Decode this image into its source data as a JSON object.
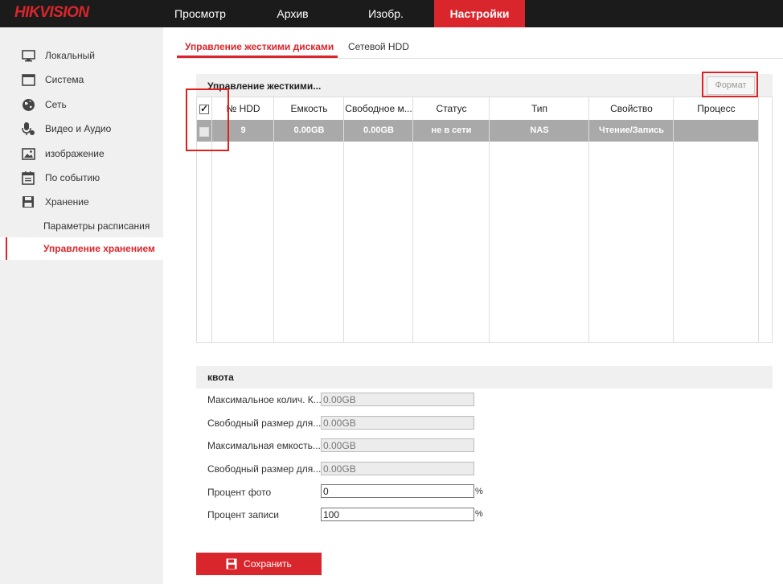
{
  "brand": "HIKVISION",
  "nav": {
    "tabs": [
      "Просмотр",
      "Архив",
      "Изобр.",
      "Настройки"
    ],
    "active": "Настройки"
  },
  "sidebar": {
    "items": [
      {
        "label": "Локальный",
        "icon": "monitor-icon"
      },
      {
        "label": "Система",
        "icon": "system-icon"
      },
      {
        "label": "Сеть",
        "icon": "globe-icon"
      },
      {
        "label": "Видео и Аудио",
        "icon": "microphone-icon"
      },
      {
        "label": "изображение",
        "icon": "image-icon"
      },
      {
        "label": "По событию",
        "icon": "calendar-icon"
      },
      {
        "label": "Хранение",
        "icon": "save-icon"
      }
    ],
    "subitems": [
      "Параметры расписания",
      "Управление хранением"
    ],
    "active_subitem": "Управление хранением"
  },
  "subtabs": [
    "Управление жесткими дисками",
    "Сетевой HDD"
  ],
  "hdd_panel": {
    "title": "Управление жесткими...",
    "format_label": "Формат",
    "columns": [
      "№ HDD",
      "Емкость",
      "Свободное м...",
      "Статус",
      "Тип",
      "Свойство",
      "Процесс"
    ],
    "header_checked": true,
    "rows": [
      {
        "checked": false,
        "hdd": "9",
        "capacity": "0.00GB",
        "free": "0.00GB",
        "status": "не в сети",
        "type": "NAS",
        "property": "Чтение/Запись",
        "process": ""
      }
    ]
  },
  "quota": {
    "title": "квота",
    "fields": [
      {
        "label": "Максимальное колич. К...",
        "value": "0.00GB",
        "readonly": true
      },
      {
        "label": "Свободный размер для...",
        "value": "0.00GB",
        "readonly": true
      },
      {
        "label": "Максимальная емкость...",
        "value": "0.00GB",
        "readonly": true
      },
      {
        "label": "Свободный размер для...",
        "value": "0.00GB",
        "readonly": true
      },
      {
        "label": "Процент фото",
        "value": "0",
        "readonly": false,
        "unit": "%"
      },
      {
        "label": "Процент записи",
        "value": "100",
        "readonly": false,
        "unit": "%"
      }
    ]
  },
  "save_label": "Сохранить",
  "colors": {
    "accent": "#d9262c",
    "topbar": "#1b1b1b",
    "sidebar": "#f0f0f0",
    "highlight_box": "#e0201f",
    "selected_row": "#a9a9a9"
  }
}
